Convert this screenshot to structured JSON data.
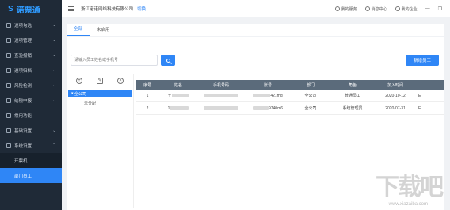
{
  "app": {
    "logo_text": "诺票通",
    "logo_mark": "S"
  },
  "sidebar": {
    "items": [
      {
        "label": "进项勾选"
      },
      {
        "label": "进项管理"
      },
      {
        "label": "查验报销"
      },
      {
        "label": "进项归档"
      },
      {
        "label": "风险检测"
      },
      {
        "label": "纳税申报"
      },
      {
        "label": "常用功能"
      },
      {
        "label": "基础设置"
      },
      {
        "label": "系统设置"
      }
    ],
    "subitems": [
      {
        "label": "开票机"
      },
      {
        "label": "部门员工"
      }
    ]
  },
  "topbar": {
    "company": "浙江诺诺网络科技有限公司",
    "switch_label": "切换",
    "service": "我的服务",
    "messages": "消息中心",
    "my_company": "我的企业",
    "minimize": "—",
    "restore": "❐"
  },
  "tabs": [
    {
      "label": "全部"
    },
    {
      "label": "未启用"
    }
  ],
  "search": {
    "placeholder": "请输入员工姓名或手机号"
  },
  "buttons": {
    "new_employee": "新增员工"
  },
  "tree": {
    "root": "全公司",
    "child": "未分配"
  },
  "table": {
    "headers": [
      "序号",
      "姓名",
      "手机号码",
      "账号",
      "部门",
      "角色",
      "加入时间",
      ""
    ],
    "rows": [
      {
        "no": "1",
        "name": "王",
        "account": "421mg",
        "dept": "全公司",
        "role": "普通员工",
        "date": "2020-10-12",
        "extra": "E"
      },
      {
        "no": "2",
        "name": "1",
        "account": "9740m6",
        "dept": "全公司",
        "role": "系统管理员",
        "date": "2020-07-31",
        "extra": "E"
      }
    ]
  },
  "watermark": {
    "big": "下载吧",
    "small": "www.xiazaiba.com"
  }
}
